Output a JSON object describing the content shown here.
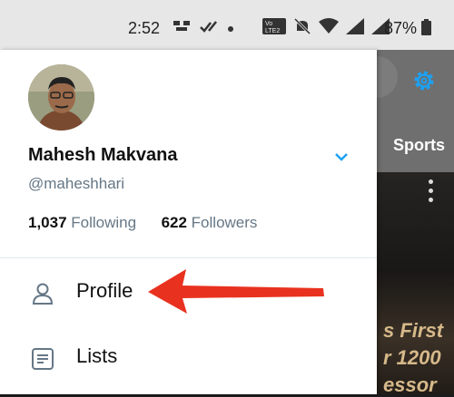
{
  "status_bar": {
    "time": "2:52",
    "battery": "87%"
  },
  "background": {
    "sports_tab": "Sports",
    "image_text": [
      "s First",
      "r 1200",
      "essor"
    ]
  },
  "drawer": {
    "name": "Mahesh Makvana",
    "handle": "@maheshhari",
    "following_count": "1,037",
    "following_label": "Following",
    "followers_count": "622",
    "followers_label": "Followers",
    "menu": [
      {
        "label": "Profile",
        "icon": "person-icon"
      },
      {
        "label": "Lists",
        "icon": "lists-icon"
      }
    ]
  },
  "colors": {
    "accent": "#1da1f2",
    "annotation_arrow": "#e8321f",
    "secondary_text": "#657786"
  }
}
